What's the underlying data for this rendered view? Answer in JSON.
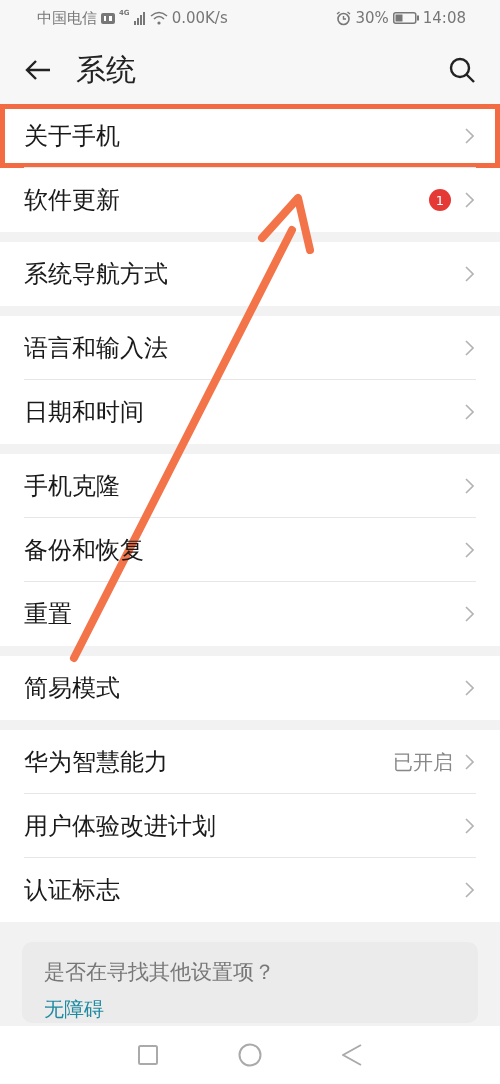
{
  "status_bar": {
    "carrier": "中国电信",
    "network": "4G",
    "speed": "0.00K/s",
    "battery": "30%",
    "time": "14:08"
  },
  "header": {
    "title": "系统"
  },
  "groups": [
    {
      "items": [
        {
          "label": "关于手机",
          "highlighted": true
        },
        {
          "label": "软件更新",
          "badge": "1",
          "highlighted": false
        }
      ]
    },
    {
      "items": [
        {
          "label": "系统导航方式",
          "highlighted": false
        }
      ]
    },
    {
      "items": [
        {
          "label": "语言和输入法",
          "highlighted": false
        },
        {
          "label": "日期和时间",
          "highlighted": false
        }
      ]
    },
    {
      "items": [
        {
          "label": "手机克隆",
          "highlighted": false
        },
        {
          "label": "备份和恢复",
          "highlighted": false
        },
        {
          "label": "重置",
          "highlighted": false
        }
      ]
    },
    {
      "items": [
        {
          "label": "简易模式",
          "highlighted": false
        }
      ]
    },
    {
      "items": [
        {
          "label": "华为智慧能力",
          "value": "已开启",
          "highlighted": false
        },
        {
          "label": "用户体验改进计划",
          "highlighted": false
        },
        {
          "label": "认证标志",
          "highlighted": false
        }
      ]
    }
  ],
  "suggestion": {
    "title": "是否在寻找其他设置项？",
    "link": "无障碍"
  }
}
